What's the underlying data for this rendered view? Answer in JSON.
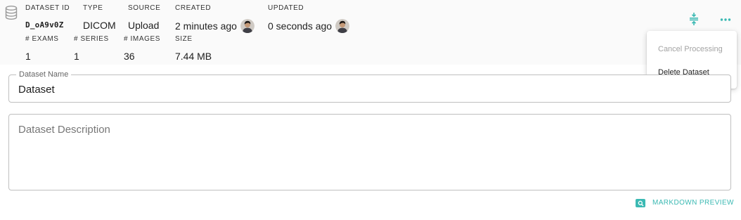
{
  "dataset": {
    "id_label": "DATASET ID",
    "id_value": "D_oA9v0Z",
    "type_label": "TYPE",
    "type_value": "DICOM",
    "source_label": "SOURCE",
    "source_value": "Upload",
    "created_label": "CREATED",
    "created_value": "2 minutes ago",
    "updated_label": "UPDATED",
    "updated_value": "0 seconds ago",
    "exams_label": "# EXAMS",
    "exams_value": "1",
    "series_label": "# SERIES",
    "series_value": "1",
    "images_label": "# IMAGES",
    "images_value": "36",
    "size_label": "SIZE",
    "size_value": "7.44 MB"
  },
  "menu": {
    "cancel_label": "Cancel Processing",
    "delete_label": "Delete Dataset"
  },
  "form": {
    "name_label": "Dataset Name",
    "name_value": "Dataset",
    "description_placeholder": "Dataset Description"
  },
  "markdown_preview_label": "MARKDOWN PREVIEW",
  "icons": {
    "database": "database-icon",
    "collapse": "collapse-icon",
    "more": "more-horizontal-icon",
    "avatar": "user-avatar",
    "preview": "search-icon"
  },
  "colors": {
    "accent": "#3bb9b3",
    "header_bg": "#fafafa",
    "disabled_text": "#a3a3a3"
  }
}
